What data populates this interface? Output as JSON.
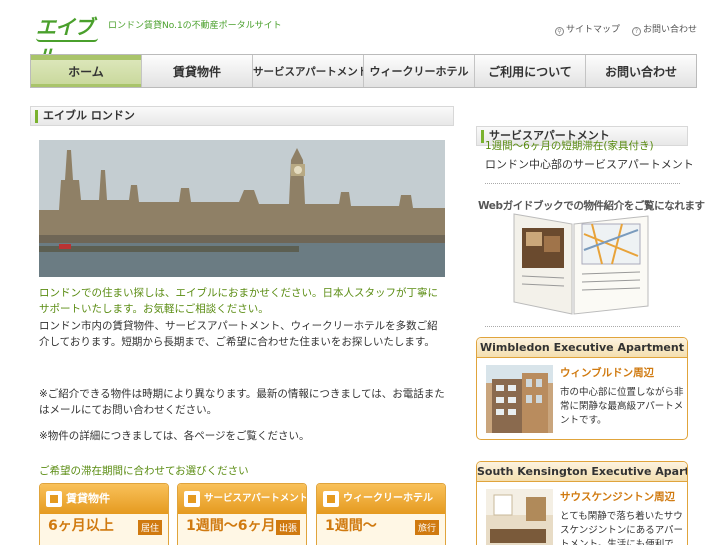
{
  "header": {
    "logo_text": "エイブル",
    "tagline": "ロンドン賃貸No.1の不動産ポータルサイト",
    "utility_links": [
      {
        "label": "サイトマップ",
        "icon": "search-icon"
      },
      {
        "label": "お問い合わせ",
        "icon": "help-icon"
      }
    ]
  },
  "nav": {
    "tabs": [
      {
        "label": "ホーム",
        "active": true
      },
      {
        "label": "賃貸物件",
        "active": false
      },
      {
        "label": "サービスアパートメント",
        "active": false
      },
      {
        "label": "ウィークリーホテル",
        "active": false
      },
      {
        "label": "ご利用について",
        "active": false
      },
      {
        "label": "お問い合わせ",
        "active": false
      }
    ]
  },
  "main": {
    "section_title": "エイブル ロンドン",
    "heading": "ロンドンでの住まい探しは、エイブルにおまかせください。日本人スタッフが丁寧にサポートいたします。お気軽にご相談ください。",
    "description": "ロンドン市内の賃貸物件、サービスアパートメント、ウィークリーホテルを多数ご紹介しております。短期から長期まで、ご希望に合わせた住まいをお探しいたします。",
    "note1": "※ご紹介できる物件は時期により異なります。最新の情報につきましては、お電話またはメールにてお問い合わせください。",
    "note2": "※物件の詳細につきましては、各ページをご覧ください。",
    "categories_title": "ご希望の滞在期間に合わせてお選びください",
    "categories": [
      {
        "title": "賃貸物件",
        "term": "6ヶ月以上",
        "tag": "居住",
        "icon": "home-icon"
      },
      {
        "title": "サービスアパートメント",
        "term": "1週間〜6ヶ月",
        "tag": "出張",
        "icon": "building-icon"
      },
      {
        "title": "ウィークリーホテル",
        "term": "1週間〜",
        "tag": "旅行",
        "icon": "bed-icon"
      }
    ]
  },
  "sidebar": {
    "section_title": "サービスアパートメント",
    "link": "1週間〜6ヶ月の短期滞在(家具付き)",
    "text": "ロンドン中心部のサービスアパートメント",
    "webguide": "Webガイドブックでの物件紹介をご覧になれます",
    "properties": [
      {
        "name": "Wimbledon Executive Apartment",
        "area": "ウィンブルドン周辺",
        "desc": "市の中心部に位置しながら非常に閑静な最高級アパートメントです。"
      },
      {
        "name": "South Kensington Executive Apartment",
        "area": "サウスケンジントン周辺",
        "desc": "とても閑静で落ち着いたサウスケンジントンにあるアパートメント。生活にも便利です。"
      }
    ]
  },
  "colors": {
    "accent_green": "#5a8c12",
    "nav_active": "#c8d79a",
    "orange": "#e59a1f"
  }
}
